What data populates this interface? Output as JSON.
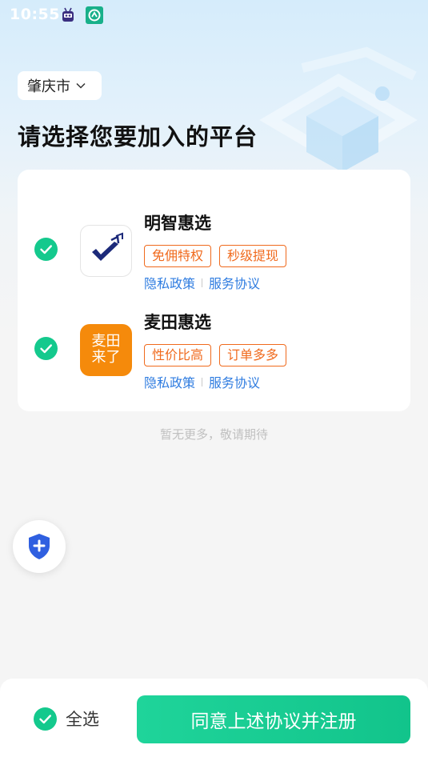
{
  "status_bar": {
    "time": "10:55",
    "icons": [
      "robot-notification-icon",
      "app-notification-icon"
    ]
  },
  "city_selector": {
    "label": "肇庆市",
    "icon": "chevron-down-icon"
  },
  "page_title": "请选择您要加入的平台",
  "platforms": [
    {
      "name": "明智惠选",
      "checked": true,
      "logo_icon": "mingzhi-checkmark-logo",
      "tags": [
        "免佣特权",
        "秒级提现"
      ],
      "privacy_link": "隐私政策",
      "service_link": "服务协议"
    },
    {
      "name": "麦田惠选",
      "checked": true,
      "logo_text_line1": "麦田",
      "logo_text_line2": "来了",
      "logo_color": "#f58a0b",
      "tags": [
        "性价比高",
        "订单多多"
      ],
      "privacy_link": "隐私政策",
      "service_link": "服务协议"
    }
  ],
  "no_more_text": "暂无更多，敬请期待",
  "floating_button": {
    "icon": "shield-plus-icon"
  },
  "bottom_bar": {
    "select_all_label": "全选",
    "select_all_checked": true,
    "agree_button_label": "同意上述协议并注册"
  },
  "colors": {
    "accent_green": "#14c98d",
    "tag_orange": "#f06a1d",
    "link_blue": "#2f7ce0",
    "shield_blue": "#2f5fe0"
  }
}
